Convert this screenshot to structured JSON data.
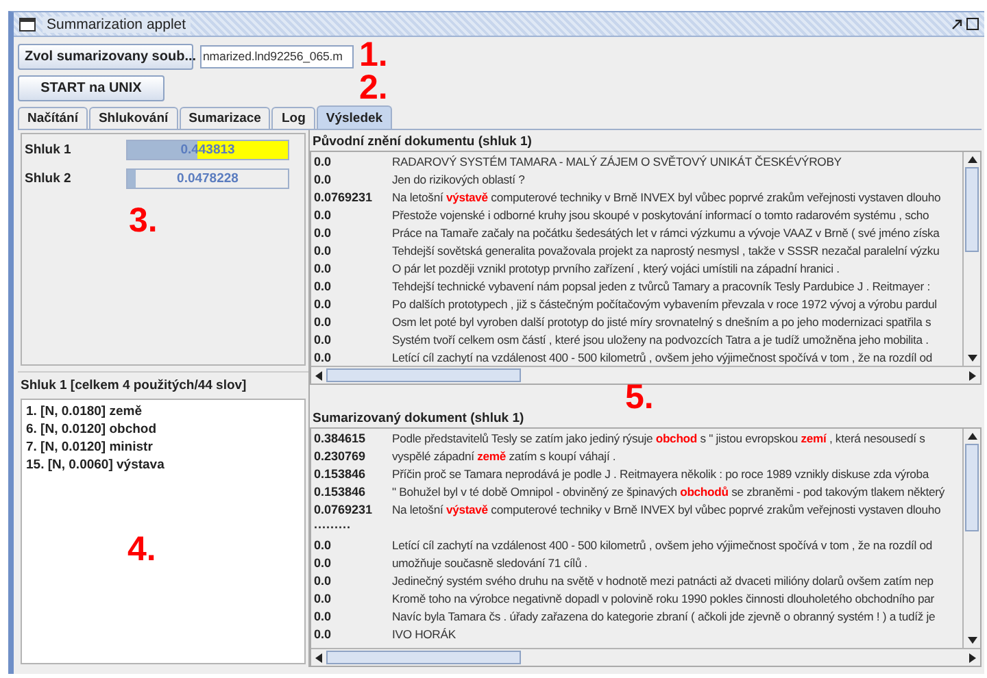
{
  "window": {
    "title": "Summarization applet"
  },
  "toolbar": {
    "choose_button": "Zvol sumarizovany soub...",
    "file_field": {
      "value": "nmarized.lnd92256_065.m"
    },
    "start_button": "START na UNIX"
  },
  "tabs": [
    {
      "label": "Načítání",
      "selected": false
    },
    {
      "label": "Shlukování",
      "selected": false
    },
    {
      "label": "Sumarizace",
      "selected": false
    },
    {
      "label": "Log",
      "selected": false
    },
    {
      "label": "Výsledek",
      "selected": true
    }
  ],
  "clusters": [
    {
      "name": "Shluk 1",
      "level": 0.44,
      "reading": "0.443813",
      "highlighted": true
    },
    {
      "name": "Shluk 2",
      "level": 0.048,
      "reading": "0.0478228",
      "highlighted": false
    }
  ],
  "word_list": {
    "title": "Shluk 1 [celkem 4 použitých/44 slov]",
    "items": [
      "1. [N, 0.0180]  země",
      "6. [N, 0.0120]  obchod",
      "7. [N, 0.0120]  ministr",
      "15. [N, 0.0060]  výstava"
    ]
  },
  "original": {
    "title": "Původní znění dokumentu (shluk 1)",
    "rows": [
      {
        "score": "0.0",
        "text": "RADAROVÝ SYSTÉM TAMARA  - MALÝ  ZÁJEM  O SVĚTOVÝ UNIKÁT ČESKÉVÝROBY"
      },
      {
        "score": "0.0",
        "text": "Jen do rizikových   oblastí ?"
      },
      {
        "score": "0.0769231",
        "text": "Na letošní **výstavě** computerové  techniky  v Brně INVEX byl vůbec  poprvé  zrakům  veřejnosti  vystaven  dlouho"
      },
      {
        "score": "0.0",
        "text": "Přestože  vojenské  i odborné  kruhy  jsou skoupé v poskytování  informací  o tomto  radarovém  systému  , scho"
      },
      {
        "score": "0.0",
        "text": "Práce  na Tamaře začaly  na počátku  šedesátých  let v rámci výzkumu   a vývoje  VAAZ  v Brně ( své jméno získa"
      },
      {
        "score": "0.0",
        "text": "Tehdejší sovětská  generalita považovala  projekt za naprostý  nesmysl , takže  v SSSR nezačal  paralelní výzku"
      },
      {
        "score": "0.0",
        "text": "O pár let později vznikl  prototyp  prvního zařízení  , který  vojáci  umístili na západní hranici  ."
      },
      {
        "score": "0.0",
        "text": "Tehdejší technické  vybavení  nám popsal jeden z tvůrců  Tamary  a pracovník  Tesly Pardubice J . Reitmayer :"
      },
      {
        "score": "0.0",
        "text": "Po dalších prototypech   , již s částečným  počítačovým  vybavením  převzala v roce 1972 vývoj  a výrobu  pardul"
      },
      {
        "score": "0.0",
        "text": "Osm let poté byl vyroben  další prototyp  do jisté míry srovnatelný  s dnešním a po jeho modernizaci  spatřila  s"
      },
      {
        "score": "0.0",
        "text": "Systém  tvoří  celkem  osm částí  , které  jsou uloženy  na podvozcích  Tatra  a je tudíž  umožněna jeho mobilita  ."
      },
      {
        "score": "0.0",
        "text": "Letící  cíl zachytí  na vzdálenost  400 - 500 kilometrů  , ovšem jeho výjimečnost  spočívá v tom , že na rozdíl  od"
      }
    ]
  },
  "summary": {
    "title": "Sumarizovaný dokument (shluk 1)",
    "rows": [
      {
        "score": "0.384615",
        "text": "Podle představitelů  Tesly se zatím  jako jediný rýsuje  **obchod** s \" jistou evropskou  **zemí** , která  nesousedí s"
      },
      {
        "score": "0.230769",
        "text": "vyspělé  západní  **země** zatím  s koupí váhají ."
      },
      {
        "score": "0.153846",
        "text": "Příčin  proč  se Tamara neprodává je podle J . Reitmayera  několik : po roce  1989 vznikly  diskuse zda výroba"
      },
      {
        "score": "0.153846",
        "text": "\" Bohužel  byl v té době Omnipol - obviněný ze špinavých  **obchodů** se zbraněmi  - pod takovým  tlakem  některý"
      },
      {
        "score": "0.0769231",
        "text": "Na letošní  **výstavě** computerové  techniky  v Brně INVEX byl vůbec  poprvé  zrakům  veřejnosti  vystaven  dlouho"
      },
      {
        "score": "·········",
        "text": ""
      },
      {
        "score": "0.0",
        "text": "Letící  cíl zachytí  na vzdálenost  400 - 500 kilometrů  , ovšem jeho výjimečnost  spočívá v tom , že na rozdíl  od"
      },
      {
        "score": "0.0",
        "text": "umožňuje současně sledování 71 cílů ."
      },
      {
        "score": "0.0",
        "text": "Jedinečný  systém  svého druhu na světě  v hodnotě mezi patnácti  až dvaceti  milióny dolarů ovšem zatím  nep"
      },
      {
        "score": "0.0",
        "text": "Kromě toho na výrobce  negativně  dopadl v polovině roku  1990 pokles činnosti  dlouholetého obchodního par"
      },
      {
        "score": "0.0",
        "text": "Navíc byla Tamara čs . úřady zařazena  do kategorie  zbraní  ( ačkoli  jde zjevně  o obranný systém ! ) a tudíž je"
      },
      {
        "score": "0.0",
        "text": "IVO HORÁK"
      }
    ]
  },
  "annotations": [
    "1.",
    "2.",
    "3.",
    "4.",
    "5."
  ]
}
